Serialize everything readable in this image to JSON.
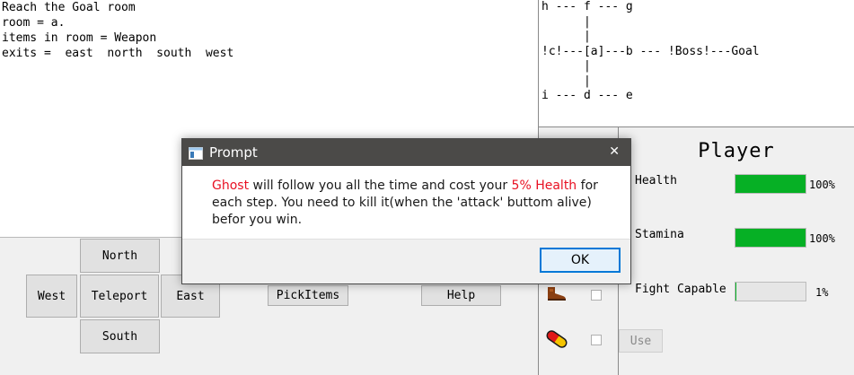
{
  "console": {
    "lines": [
      "Reach the Goal room",
      "room = a.",
      "items in room = Weapon",
      "exits =  east  north  south  west"
    ]
  },
  "map": {
    "lines": [
      "h --- f --- g",
      "      |",
      "      |",
      "!c!---[a]---b --- !Boss!---Goal",
      "      |",
      "      |",
      "i --- d --- e"
    ]
  },
  "controls": {
    "north": "North",
    "south": "South",
    "west": "West",
    "east": "East",
    "teleport": "Teleport",
    "pick_items": "PickItems",
    "help": "Help"
  },
  "inventory": {
    "items": [
      {
        "icon": "boot-icon",
        "checked": false
      },
      {
        "icon": "pill-capsule-icon",
        "checked": false
      }
    ],
    "use_label": "Use"
  },
  "player": {
    "title": "Player",
    "stats": [
      {
        "label": "Health",
        "value": 100,
        "value_text": "100%"
      },
      {
        "label": "Stamina",
        "value": 100,
        "value_text": "100%"
      },
      {
        "label": "Fight Capable",
        "value": 1,
        "value_text": "1%"
      }
    ],
    "bar_color": "#06b025"
  },
  "dialog": {
    "title": "Prompt",
    "message": {
      "part1": "Ghost",
      "part2": " will follow you all the time and cost your ",
      "part3": "5% Health",
      "part4": " for each step. You need to kill it(when the 'attack' buttom alive) befor you win."
    },
    "ok_label": "OK",
    "close_symbol": "✕"
  }
}
